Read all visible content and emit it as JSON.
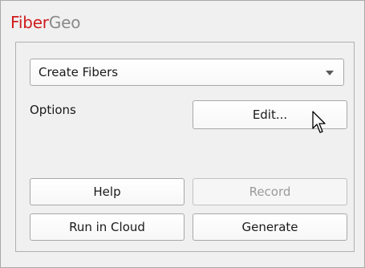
{
  "app": {
    "title_part1": "Fiber",
    "title_part2": "Geo"
  },
  "dropdown": {
    "selected": "Create Fibers"
  },
  "options": {
    "label": "Options",
    "edit_label": "Edit..."
  },
  "buttons": {
    "help": "Help",
    "record": "Record",
    "run_in_cloud": "Run in Cloud",
    "generate": "Generate"
  },
  "colors": {
    "brand_red": "#d11c1c",
    "brand_gray": "#8a8a8a"
  },
  "icons": {
    "dropdown": "chevron-down-icon",
    "cursor": "mouse-pointer-icon"
  }
}
